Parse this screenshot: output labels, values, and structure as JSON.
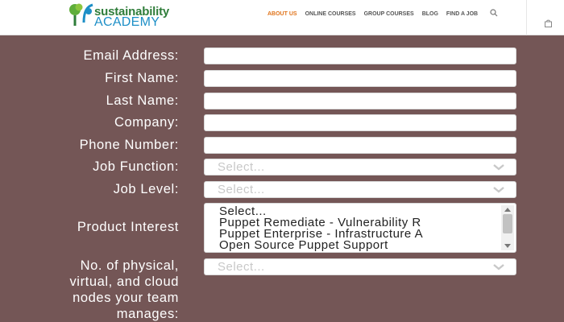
{
  "header": {
    "logo_line1": "sustainability",
    "logo_line2": "ACADEMY",
    "nav": [
      "ABOUT US",
      "ONLINE COURSES",
      "GROUP COURSES",
      "BLOG",
      "FIND A JOB"
    ],
    "accent": "#e0731a"
  },
  "form": {
    "email_label": "Email Address:",
    "first_name_label": "First Name:",
    "last_name_label": "Last Name:",
    "company_label": "Company:",
    "phone_label": "Phone Number:",
    "job_function_label": "Job Function:",
    "job_function_value": "Select...",
    "job_level_label": "Job Level:",
    "job_level_value": "Select...",
    "product_interest_label": "Product Interest",
    "product_options": [
      "Select...",
      "Puppet Remediate - Vulnerability R",
      "Puppet Enterprise - Infrastructure A",
      "Open Source Puppet Support"
    ],
    "nodes_label_1": "No. of physical,",
    "nodes_label_2": "virtual, and cloud",
    "nodes_label_3": "nodes your team",
    "nodes_label_4": "manages:",
    "nodes_value": "Select..."
  }
}
